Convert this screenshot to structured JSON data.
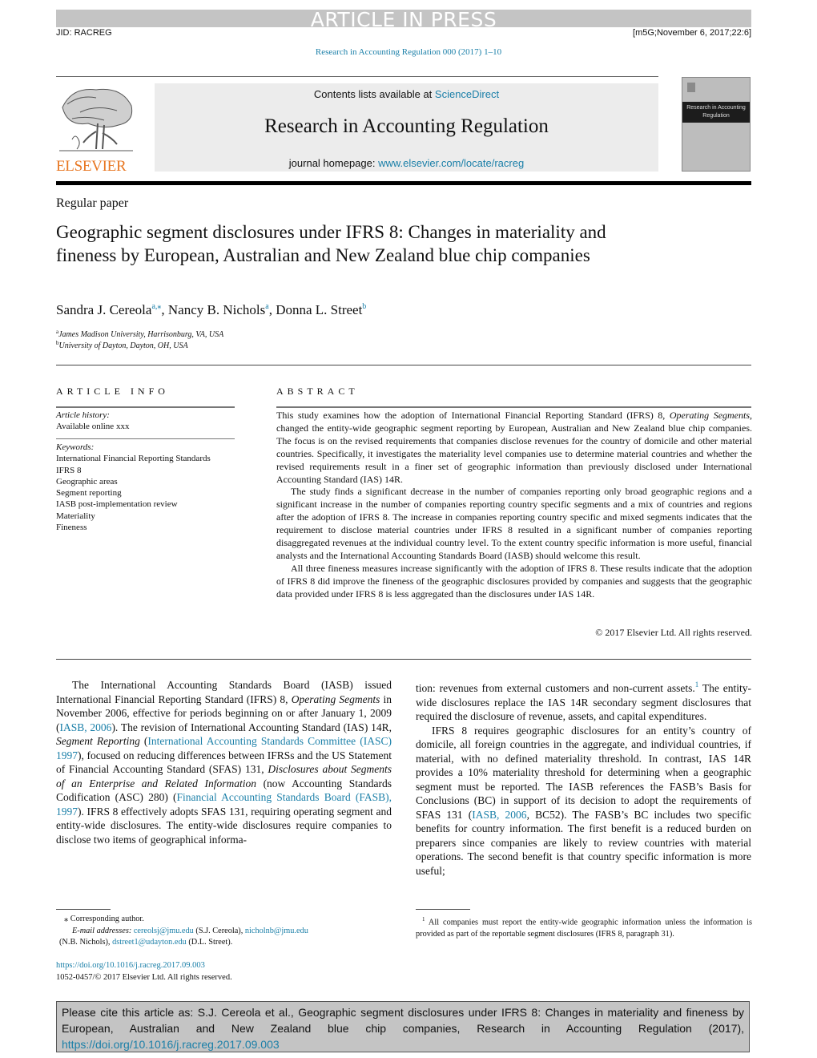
{
  "banner": {
    "text": "ARTICLE IN PRESS"
  },
  "header": {
    "jid": "JID: RACREG",
    "stamp": "[m5G;November 6, 2017;22:6]",
    "journal_ref": "Research in Accounting Regulation 000 (2017) 1–10"
  },
  "masthead": {
    "publisher_logo_text": "ELSEVIER",
    "contents_prefix": "Contents lists available at ",
    "contents_link": "ScienceDirect",
    "journal_title": "Research in Accounting Regulation",
    "homepage_prefix": "journal homepage: ",
    "homepage_link": "www.elsevier.com/locate/racreg",
    "cover_title": "Research in Accounting Regulation"
  },
  "article": {
    "type": "Regular paper",
    "title": "Geographic segment disclosures under IFRS 8: Changes in materiality and fineness by European, Australian and New Zealand blue chip companies",
    "authors": [
      {
        "name": "Sandra J. Cereola",
        "marks": "a,⁎"
      },
      {
        "name": "Nancy B. Nichols",
        "marks": "a"
      },
      {
        "name": "Donna L. Street",
        "marks": "b"
      }
    ],
    "affiliations": [
      {
        "mark": "a",
        "text": "James Madison University, Harrisonburg, VA, USA"
      },
      {
        "mark": "b",
        "text": "University of Dayton, Dayton, OH, USA"
      }
    ]
  },
  "article_info": {
    "heading": "ARTICLE INFO",
    "history_label": "Article history:",
    "history_value": "Available online xxx",
    "keywords_label": "Keywords:",
    "keywords": [
      "International Financial Reporting Standards",
      "IFRS 8",
      "Geographic areas",
      "Segment reporting",
      "IASB post-implementation review",
      "Materiality",
      "Fineness"
    ]
  },
  "abstract": {
    "heading": "ABSTRACT",
    "p1_a": "This study examines how the adoption of International Financial Reporting Standard (IFRS) 8, ",
    "p1_italic": "Operating Segments",
    "p1_b": ", changed the entity-wide geographic segment reporting by European, Australian and New Zealand blue chip companies. The focus is on the revised requirements that companies disclose revenues for the country of domicile and other material countries. Specifically, it investigates the materiality level companies use to determine material countries and whether the revised requirements result in a finer set of geographic information than previously disclosed under International Accounting Standard (IAS) 14R.",
    "p2": "The study finds a significant decrease in the number of companies reporting only broad geographic regions and a significant increase in the number of companies reporting country specific segments and a mix of countries and regions after the adoption of IFRS 8. The increase in companies reporting country specific and mixed segments indicates that the requirement to disclose material countries under IFRS 8 resulted in a significant number of companies reporting disaggregated revenues at the individual country level. To the extent country specific information is more useful, financial analysts and the International Accounting Standards Board (IASB) should welcome this result.",
    "p3": "All three fineness measures increase significantly with the adoption of IFRS 8. These results indicate that the adoption of IFRS 8 did improve the fineness of the geographic disclosures provided by companies and suggests that the geographic data provided under IFRS 8 is less aggregated than the disclosures under IAS 14R.",
    "copyright": "© 2017 Elsevier Ltd. All rights reserved."
  },
  "body": {
    "left": {
      "s1": "The International Accounting Standards Board (IASB) issued International Financial Reporting Standard (IFRS) 8, ",
      "s1_it": "Operating Segments",
      "s2": " in November 2006, effective for periods beginning on or after January 1, 2009 (",
      "ref1": "IASB, 2006",
      "s3": "). The revision of International Accounting Standard (IAS) 14R, ",
      "s3_it": "Segment Reporting",
      "s4": " (",
      "ref2": "International Accounting Standards Committee (IASC) 1997",
      "s5": "), focused on reducing differences between IFRSs and the US Statement of Financial Accounting Standard (SFAS) 131, ",
      "s5_it": "Disclosures about Segments of an Enterprise and Related Information",
      "s6": " (now Accounting Standards Codification (ASC) 280) (",
      "ref3": "Financial Accounting Standards Board (FASB), 1997",
      "s7": "). IFRS 8 effectively adopts SFAS 131, requiring operating segment and entity-wide disclosures. The entity-wide disclosures require companies to disclose two items of geographical informa-"
    },
    "right": {
      "p1_a": "tion: revenues from external customers and non-current assets.",
      "p1_fn": "1",
      "p1_b": " The entity-wide disclosures replace the IAS 14R secondary segment disclosures that required the disclosure of revenue, assets, and capital expenditures.",
      "p2_a": "IFRS 8 requires geographic disclosures for an entity’s country of domicile, all foreign countries in the aggregate, and individual countries, if material, with no defined materiality threshold. In contrast, IAS 14R provides a 10% materiality threshold for determining when a geographic segment must be reported. The IASB references the FASB’s Basis for Conclusions (BC) in support of its decision to adopt the requirements of SFAS 131 (",
      "p2_ref": "IASB, 2006",
      "p2_b": ", BC52). The FASB’s BC includes two specific benefits for country information. The first benefit is a reduced burden on preparers since companies are likely to review countries with material operations. The second benefit is that country specific information is more useful;"
    }
  },
  "footnotes": {
    "corresponding": "⁎ Corresponding author.",
    "email_label": "E-mail addresses: ",
    "email1": "cereolsj@jmu.edu",
    "email1_name": " (S.J. Cereola), ",
    "email2": "nicholnb@jmu.edu",
    "email2_name": "(N.B. Nichols), ",
    "email3": "dstreet1@udayton.edu",
    "email3_name": " (D.L. Street).",
    "doi": "https://doi.org/10.1016/j.racreg.2017.09.003",
    "issn": "1052-0457/© 2017 Elsevier Ltd. All rights reserved.",
    "fn1_mark": "1",
    "fn1_text": " All companies must report the entity-wide geographic information unless the information is provided as part of the reportable segment disclosures (IFRS 8, paragraph 31)."
  },
  "cite": {
    "text": "Please cite this article as: S.J. Cereola et al., Geographic segment disclosures under IFRS 8: Changes in materiality and fineness by European, Australian and New Zealand blue chip companies, Research in Accounting Regulation (2017), ",
    "doi": "https://doi.org/10.1016/j.racreg.2017.09.003"
  },
  "colors": {
    "link": "#1a7fa8",
    "elsevier_orange": "#e87722",
    "banner_gray": "#c4c4c4"
  }
}
